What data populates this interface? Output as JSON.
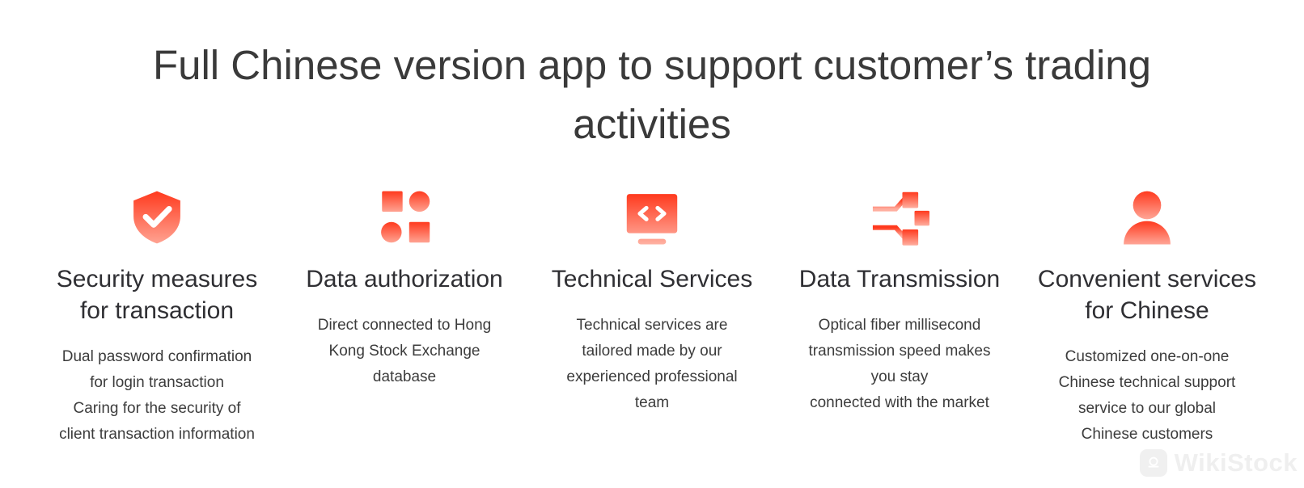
{
  "page": {
    "background_color": "#ffffff",
    "heading": "Full Chinese version app to support customer’s trading activities",
    "heading_color": "#3a3a3a"
  },
  "theme": {
    "accent_red_top": "#FF3A1E",
    "accent_red_bottom": "#FFA392",
    "title_color": "#2f2f33",
    "body_color": "#3c3c3c"
  },
  "features": [
    {
      "icon": "shield-check-icon",
      "title": "Security measures\nfor transaction",
      "description": "Dual password confirmation\nfor login transaction\nCaring for the security of\nclient transaction information"
    },
    {
      "icon": "network-nodes-icon",
      "title": "Data authorization",
      "description": "Direct connected to Hong\nKong Stock Exchange\ndatabase"
    },
    {
      "icon": "code-monitor-icon",
      "title": "Technical Services",
      "description": "Technical services are\ntailored made by our\nexperienced professional\nteam"
    },
    {
      "icon": "data-transmission-icon",
      "title": "Data Transmission",
      "description": "Optical fiber millisecond\ntransmission speed makes\nyou stay\nconnected with the market"
    },
    {
      "icon": "user-person-icon",
      "title": "Convenient services\nfor Chinese",
      "description": "Customized one-on-one\nChinese technical support\nservice to our global\nChinese customers"
    }
  ],
  "watermark": {
    "text": "WikiStock",
    "logo_icon": "wikistock-logo-icon",
    "color": "#efefef"
  }
}
